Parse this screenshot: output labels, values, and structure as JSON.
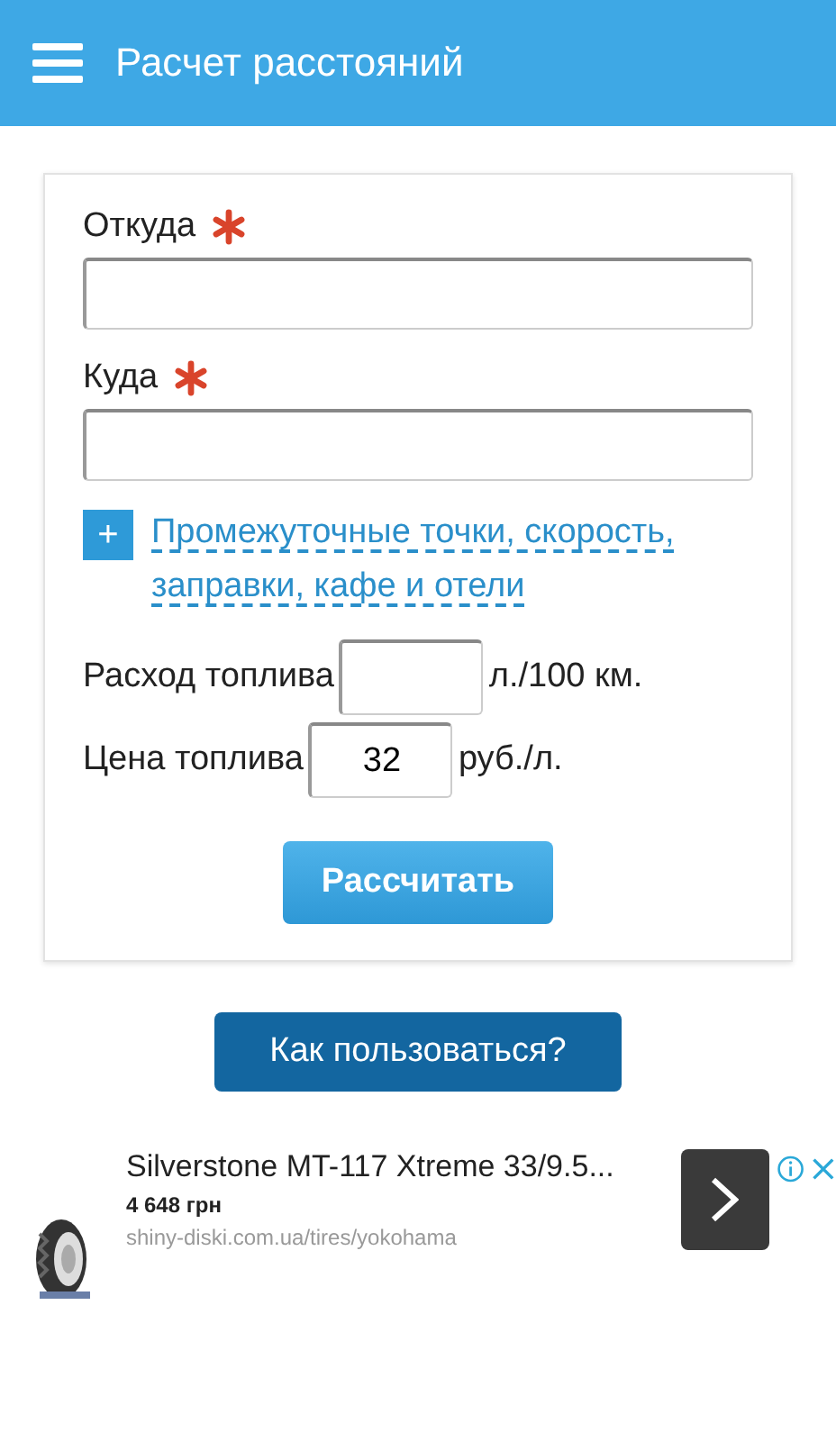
{
  "header": {
    "title": "Расчет расстояний"
  },
  "form": {
    "fields": [
      {
        "label": "Откуда",
        "required": true
      },
      {
        "label": "Куда",
        "required": true
      }
    ],
    "extras": {
      "toggle": "+",
      "link": "Промежуточные точки, скорость, заправки, кафе и отели"
    },
    "fuel": [
      {
        "label": "Расход топлива",
        "unit": "л./100 км."
      },
      {
        "label": "Цена топлива",
        "value": "32",
        "unit": "руб./л."
      }
    ],
    "submit": "Рассчитать"
  },
  "help_button": "Как пользоваться?",
  "ad": {
    "title": "Silverstone MT-117 Xtreme 33/9.5...",
    "price": "4 648 грн",
    "url": "shiny-diski.com.ua/tires/yokohama"
  }
}
